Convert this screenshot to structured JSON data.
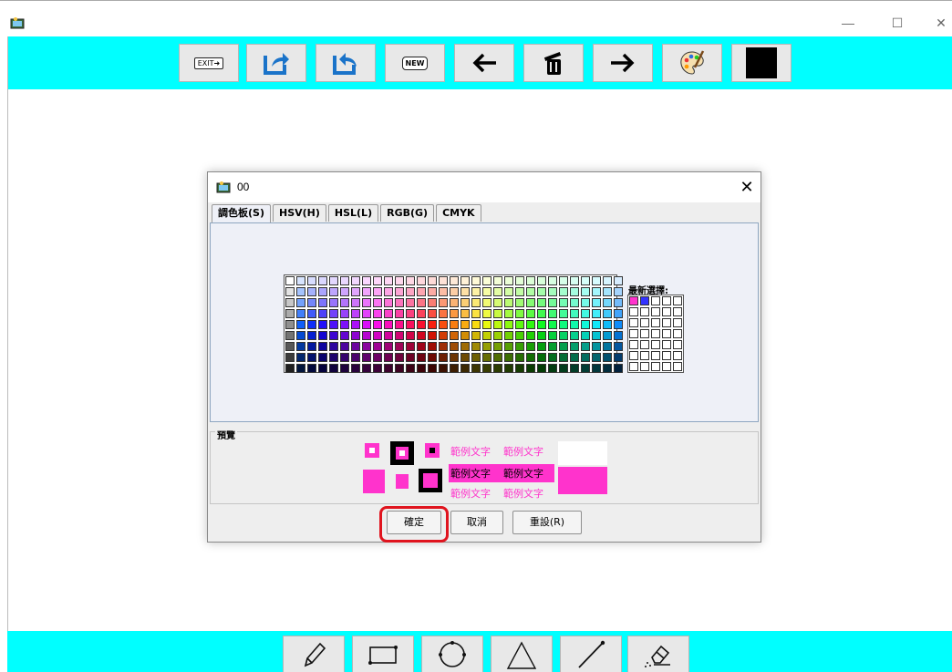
{
  "window": {
    "app_icon": "paint-app-icon",
    "controls": [
      "minimize-icon",
      "maximize-icon",
      "close-icon"
    ],
    "control_glyphs": {
      "minimize": "—",
      "maximize": "☐",
      "close": "✕"
    }
  },
  "toolbar": {
    "background": "#00ffff",
    "buttons": [
      {
        "name": "exit-button",
        "label": "EXIT➜",
        "icon": "exit-icon"
      },
      {
        "name": "export-button",
        "icon": "share-out-icon"
      },
      {
        "name": "import-button",
        "icon": "share-back-icon"
      },
      {
        "name": "new-button",
        "label": "NEW",
        "icon": "new-icon"
      },
      {
        "name": "undo-button",
        "icon": "arrow-left-icon"
      },
      {
        "name": "clear-button",
        "icon": "trash-icon"
      },
      {
        "name": "redo-button",
        "icon": "arrow-right-icon"
      },
      {
        "name": "palette-button",
        "icon": "palette-icon"
      },
      {
        "name": "current-color-button",
        "color": "#000000"
      }
    ]
  },
  "bottom_tools": [
    {
      "name": "pencil-tool-button",
      "icon": "pencil-icon"
    },
    {
      "name": "rectangle-tool-button",
      "icon": "rectangle-icon"
    },
    {
      "name": "circle-tool-button",
      "icon": "circle-icon"
    },
    {
      "name": "triangle-tool-button",
      "icon": "triangle-icon"
    },
    {
      "name": "line-tool-button",
      "icon": "line-icon"
    },
    {
      "name": "eraser-tool-button",
      "icon": "eraser-icon"
    }
  ],
  "dialog": {
    "title": "00",
    "tabs": [
      "調色板(S)",
      "HSV(H)",
      "HSL(L)",
      "RGB(G)",
      "CMYK"
    ],
    "active_tab": "調色板(S)",
    "recent_label": "最新選擇:",
    "recent_colors": [
      "#ff33cc",
      "#3333ff"
    ],
    "preview_label": "預覽",
    "sample_text": "範例文字",
    "selected_color": "#ff33cc",
    "buttons": {
      "ok": "確定",
      "cancel": "取消",
      "reset": "重設(R)"
    }
  }
}
